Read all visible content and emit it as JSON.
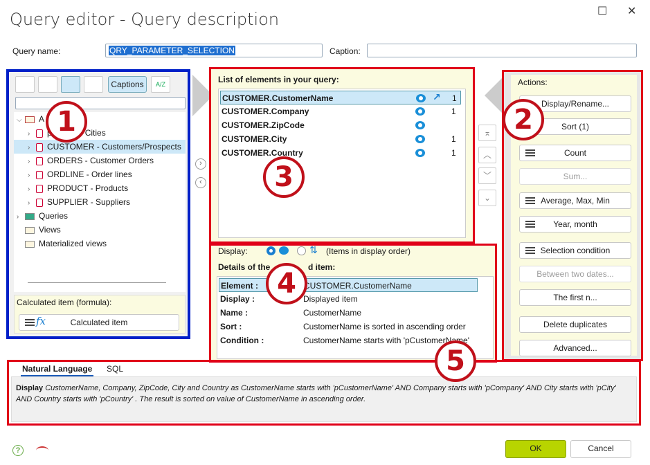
{
  "window": {
    "title": "Query editor - Query description"
  },
  "header": {
    "query_name_label": "Query name:",
    "query_name_value": "QRY_PARAMETER_SELECTION",
    "caption_label": "Caption:"
  },
  "left": {
    "toolbar": {
      "captions_label": "Captions",
      "sort_az_label": "A/Z"
    },
    "tree": [
      {
        "label": "A"
      },
      {
        "label": "p Codes / Cities"
      },
      {
        "label": "CUSTOMER  -  Customers/Prospects"
      },
      {
        "label": "ORDERS  -  Customer Orders"
      },
      {
        "label": "ORDLINE  -  Order lines"
      },
      {
        "label": "PRODUCT  -  Products"
      },
      {
        "label": "SUPPLIER  -  Suppliers"
      },
      {
        "label": "Queries"
      },
      {
        "label": "Views"
      },
      {
        "label": "Materialized views"
      }
    ],
    "calc_label": "Calculated item (formula):",
    "calc_button": "Calculated item"
  },
  "elements": {
    "heading": "List of elements in your query:",
    "rows": [
      {
        "name": "CUSTOMER.CustomerName",
        "count": "1"
      },
      {
        "name": "CUSTOMER.Company",
        "count": "1"
      },
      {
        "name": "CUSTOMER.ZipCode",
        "count": ""
      },
      {
        "name": "CUSTOMER.City",
        "count": "1"
      },
      {
        "name": "CUSTOMER.Country",
        "count": "1"
      }
    ],
    "sort_badge": "01"
  },
  "display": {
    "label": "Display:",
    "order_text": "(Items in display order)",
    "details_heading": "Details of the",
    "details_heading_end": "d item:",
    "details": [
      {
        "key": "Element :",
        "value": "CUSTOMER.CustomerName"
      },
      {
        "key": "Display :",
        "value": "Displayed item"
      },
      {
        "key": "Name :",
        "value": "CustomerName"
      },
      {
        "key": "Sort :",
        "value": "CustomerName is sorted in ascending order"
      },
      {
        "key": "Condition :",
        "value": "CustomerName  starts with 'pCustomerName'"
      }
    ]
  },
  "actions": {
    "heading": "Actions:",
    "buttons": [
      {
        "label": "Display/Rename..."
      },
      {
        "label": "Sort (1)"
      },
      {
        "label": "Count"
      },
      {
        "label": "Sum..."
      },
      {
        "label": "Average, Max, Min"
      },
      {
        "label": "Year, month"
      },
      {
        "label": "Selection condition"
      },
      {
        "label": "Between two dates..."
      },
      {
        "label": "The first n..."
      },
      {
        "label": "Delete duplicates"
      },
      {
        "label": "Advanced..."
      }
    ]
  },
  "bottom": {
    "tab_nl": "Natural Language",
    "tab_sql": "SQL",
    "description_bold": "Display",
    "description": " CustomerName, Company, ZipCode, City and Country  as CustomerName  starts with 'pCustomerName' AND Company  starts with 'pCompany' AND City  starts with 'pCity' AND Country  starts with 'pCountry' . The result is sorted on value of CustomerName in ascending order."
  },
  "footer": {
    "ok": "OK",
    "cancel": "Cancel"
  },
  "callouts": [
    "1",
    "2",
    "3",
    "4",
    "5"
  ],
  "colors": {
    "ok_green": "#b8d400",
    "selection_blue": "#cce8f8",
    "highlight_red": "#e00018",
    "panel_blue": "#0020c8"
  }
}
